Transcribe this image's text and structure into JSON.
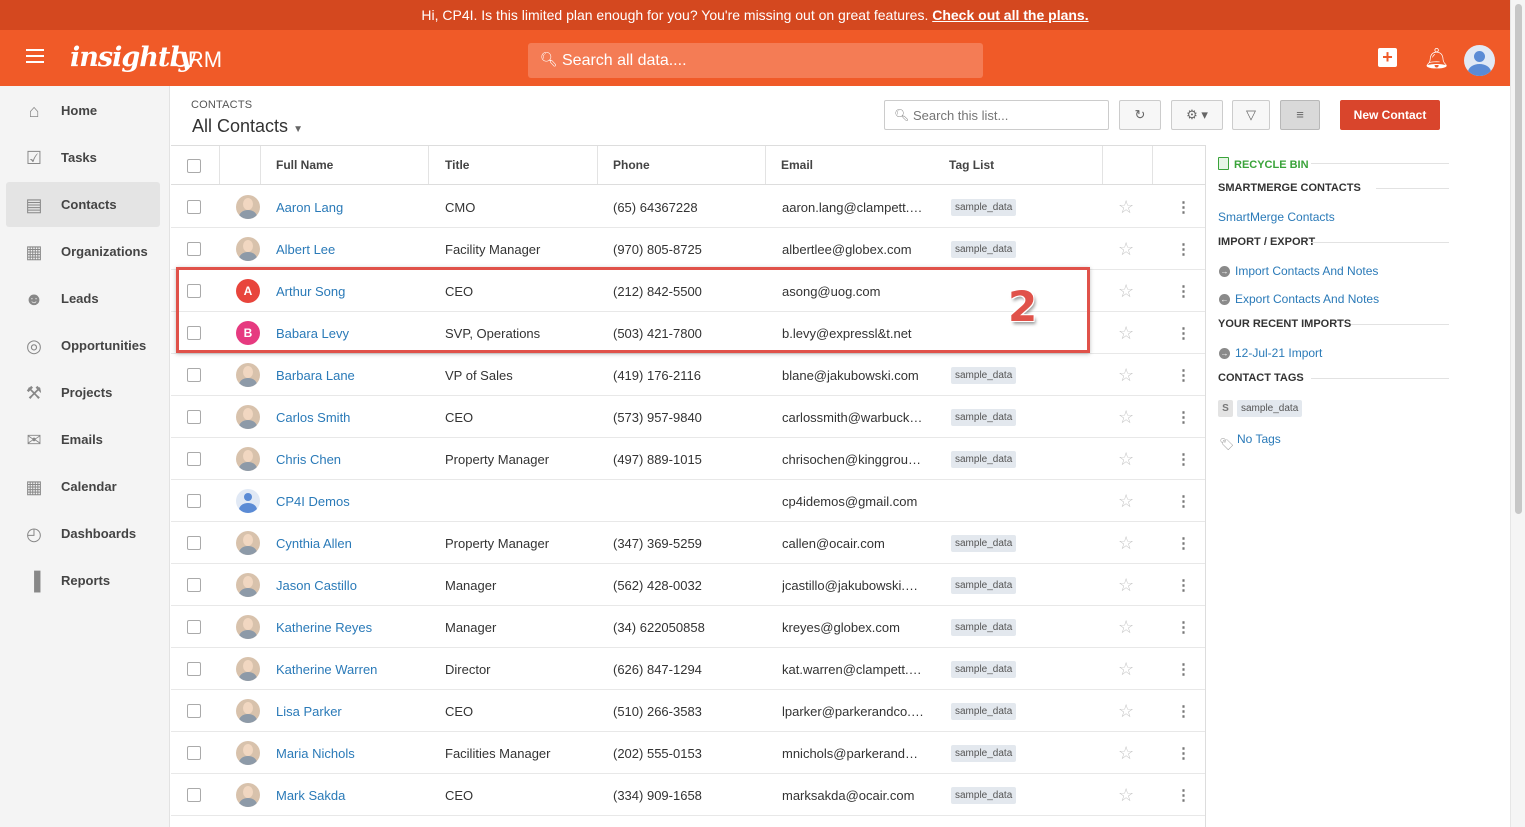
{
  "banner": {
    "message": "Hi, CP4I. Is this limited plan enough for you? You're missing out on great features.",
    "link": "Check out all the plans."
  },
  "topbar": {
    "logo": "insightly",
    "app": "CRM",
    "search_placeholder": "Search all data...."
  },
  "nav": [
    {
      "label": "Home",
      "icon": "home-icon"
    },
    {
      "label": "Tasks",
      "icon": "tasks-icon"
    },
    {
      "label": "Contacts",
      "icon": "contacts-icon",
      "active": true
    },
    {
      "label": "Organizations",
      "icon": "organizations-icon"
    },
    {
      "label": "Leads",
      "icon": "leads-icon"
    },
    {
      "label": "Opportunities",
      "icon": "opportunities-icon"
    },
    {
      "label": "Projects",
      "icon": "projects-icon"
    },
    {
      "label": "Emails",
      "icon": "emails-icon"
    },
    {
      "label": "Calendar",
      "icon": "calendar-icon"
    },
    {
      "label": "Dashboards",
      "icon": "dashboards-icon"
    },
    {
      "label": "Reports",
      "icon": "reports-icon"
    }
  ],
  "header": {
    "crumb": "CONTACTS",
    "view": "All Contacts",
    "search_placeholder": "Search this list...",
    "new_button": "New Contact"
  },
  "columns": {
    "name": "Full Name",
    "title": "Title",
    "phone": "Phone",
    "email": "Email",
    "tags": "Tag List"
  },
  "contacts": [
    {
      "name": "Aaron Lang",
      "title": "CMO",
      "phone": "(65) 64367228",
      "email": "aaron.lang@clampett.c...",
      "tag": "sample_data",
      "avatar": "photo"
    },
    {
      "name": "Albert Lee",
      "title": "Facility Manager",
      "phone": "(970) 805-8725",
      "email": "albertlee@globex.com",
      "tag": "sample_data",
      "avatar": "photo"
    },
    {
      "name": "Arthur Song",
      "title": "CEO",
      "phone": "(212) 842-5500",
      "email": "asong@uog.com",
      "tag": "",
      "avatar": "letter",
      "letter": "A",
      "color": "#e8453c"
    },
    {
      "name": "Babara Levy",
      "title": "SVP, Operations",
      "phone": "(503) 421-7800",
      "email": "b.levy@expressl&t.net",
      "tag": "",
      "avatar": "letter",
      "letter": "B",
      "color": "#e63a80"
    },
    {
      "name": "Barbara Lane",
      "title": "VP of Sales",
      "phone": "(419) 176-2116",
      "email": "blane@jakubowski.com",
      "tag": "sample_data",
      "avatar": "photo"
    },
    {
      "name": "Carlos Smith",
      "title": "CEO",
      "phone": "(573) 957-9840",
      "email": "carlossmith@warbucks....",
      "tag": "sample_data",
      "avatar": "photo"
    },
    {
      "name": "Chris Chen",
      "title": "Property Manager",
      "phone": "(497) 889-1015",
      "email": "chrisochen@kinggroup....",
      "tag": "sample_data",
      "avatar": "photo"
    },
    {
      "name": "CP4I Demos",
      "title": "",
      "phone": "",
      "email": "cp4idemos@gmail.com",
      "tag": "",
      "avatar": "generic"
    },
    {
      "name": "Cynthia Allen",
      "title": "Property Manager",
      "phone": "(347) 369-5259",
      "email": "callen@ocair.com",
      "tag": "sample_data",
      "avatar": "photo"
    },
    {
      "name": "Jason Castillo",
      "title": "Manager",
      "phone": "(562) 428-0032",
      "email": "jcastillo@jakubowski.com",
      "tag": "sample_data",
      "avatar": "photo"
    },
    {
      "name": "Katherine Reyes",
      "title": "Manager",
      "phone": "(34) 622050858",
      "email": "kreyes@globex.com",
      "tag": "sample_data",
      "avatar": "photo"
    },
    {
      "name": "Katherine Warren",
      "title": "Director",
      "phone": "(626) 847-1294",
      "email": "kat.warren@clampett.c...",
      "tag": "sample_data",
      "avatar": "photo"
    },
    {
      "name": "Lisa Parker",
      "title": "CEO",
      "phone": "(510) 266-3583",
      "email": "lparker@parkerandco.c...",
      "tag": "sample_data",
      "avatar": "photo"
    },
    {
      "name": "Maria Nichols",
      "title": "Facilities Manager",
      "phone": "(202) 555-0153",
      "email": "mnichols@parkerandco...",
      "tag": "sample_data",
      "avatar": "photo"
    },
    {
      "name": "Mark Sakda",
      "title": "CEO",
      "phone": "(334) 909-1658",
      "email": "marksakda@ocair.com",
      "tag": "sample_data",
      "avatar": "photo"
    }
  ],
  "annotation": {
    "number": "2",
    "color": "#e0524a"
  },
  "right_panel": {
    "recycle_bin": "RECYCLE BIN",
    "smartmerge_head": "SMARTMERGE CONTACTS",
    "smartmerge_link": "SmartMerge Contacts",
    "import_export_head": "IMPORT / EXPORT",
    "import_link": "Import Contacts And Notes",
    "export_link": "Export Contacts And Notes",
    "recent_head": "YOUR RECENT IMPORTS",
    "recent_link": "12-Jul-21 Import",
    "tags_head": "CONTACT TAGS",
    "tag_initial": "S",
    "tag": "sample_data",
    "no_tags": "No Tags"
  },
  "colors": {
    "brand": "#f05a28",
    "banner": "#d4481f",
    "link": "#2a7ab8",
    "primary_button": "#d9452c"
  }
}
